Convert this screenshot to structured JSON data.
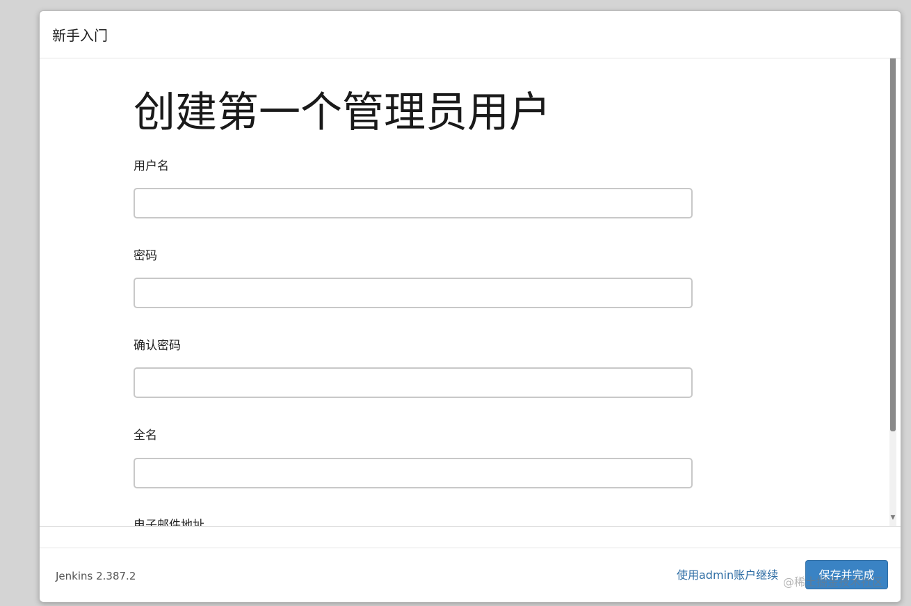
{
  "dialog": {
    "title": "新手入门"
  },
  "form": {
    "heading": "创建第一个管理员用户",
    "fields": [
      {
        "label": "用户名",
        "value": ""
      },
      {
        "label": "密码",
        "value": ""
      },
      {
        "label": "确认密码",
        "value": ""
      },
      {
        "label": "全名",
        "value": ""
      },
      {
        "label": "电子邮件地址",
        "value": ""
      }
    ]
  },
  "footer": {
    "version": "Jenkins 2.387.2",
    "continue_link": "使用admin账户继续",
    "save_button": "保存并完成"
  },
  "watermark": "@稀土掘金技术社区",
  "colors": {
    "primary_button": "#3a83c4",
    "link": "#2e6da4"
  }
}
